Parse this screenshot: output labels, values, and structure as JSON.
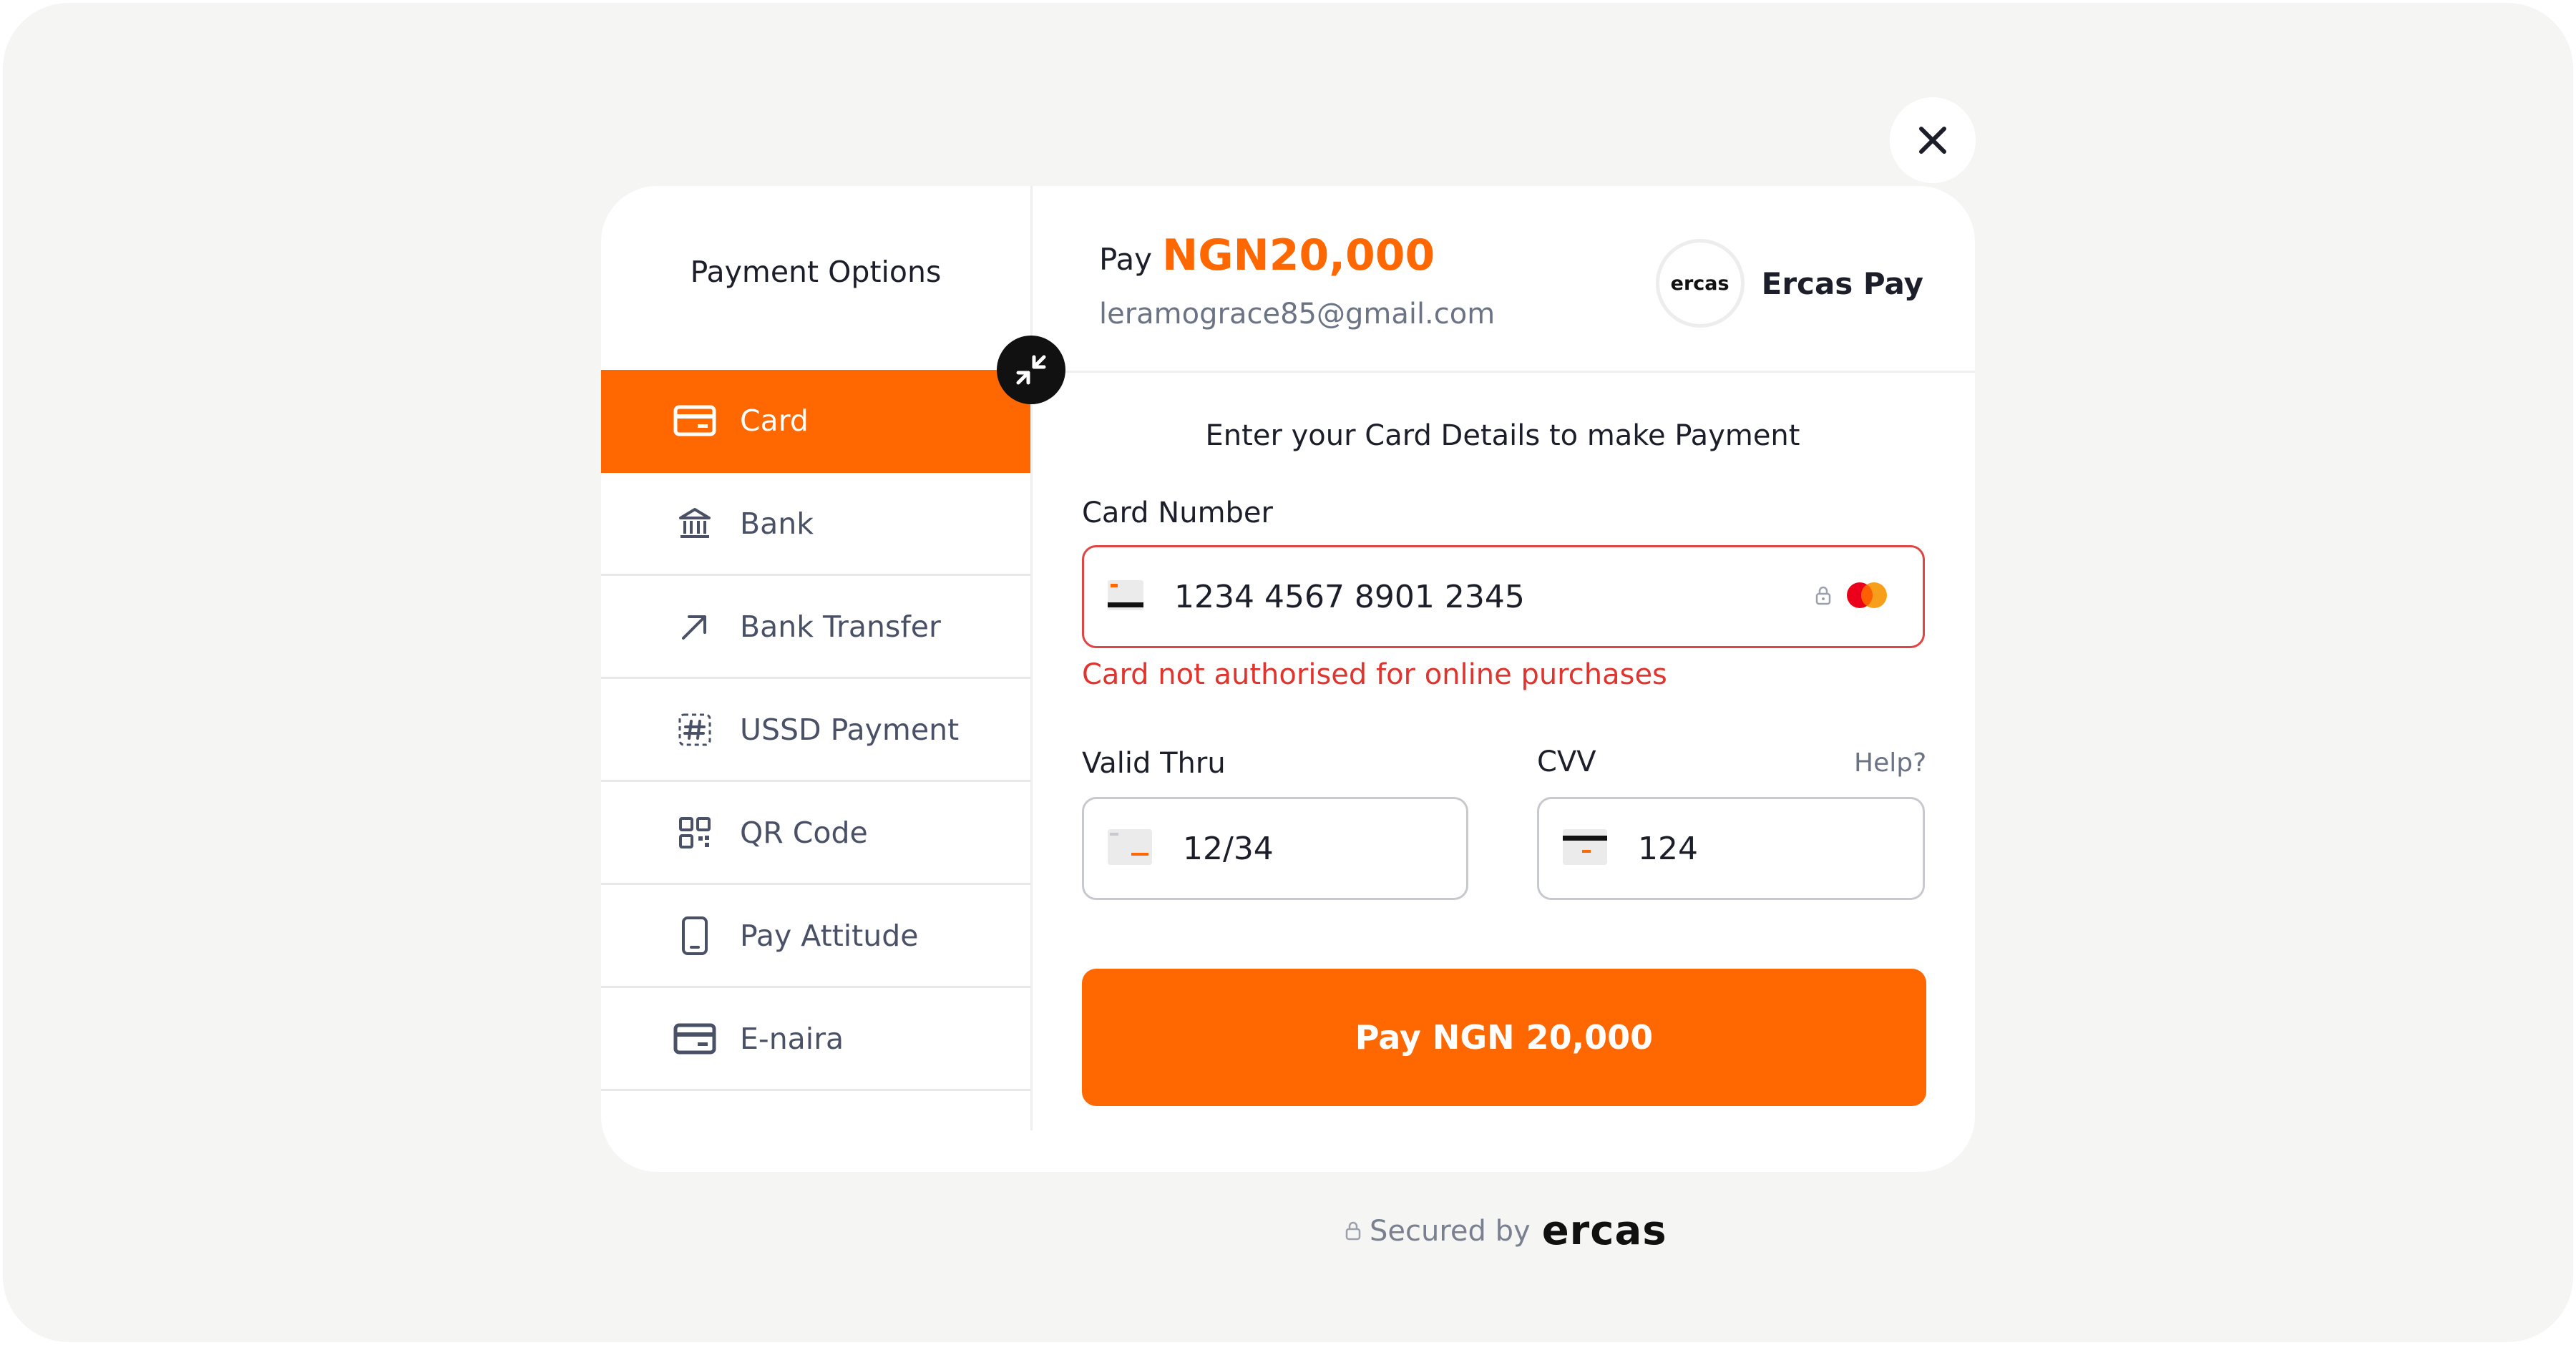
{
  "sidebar": {
    "title": "Payment Options",
    "items": [
      {
        "label": "Card",
        "icon": "credit-card-icon",
        "active": true
      },
      {
        "label": "Bank",
        "icon": "bank-icon"
      },
      {
        "label": "Bank Transfer",
        "icon": "arrow-up-right-icon"
      },
      {
        "label": "USSD Payment",
        "icon": "hashtag-icon"
      },
      {
        "label": "QR Code",
        "icon": "qr-code-icon"
      },
      {
        "label": "Pay Attitude",
        "icon": "mobile-phone-icon"
      },
      {
        "label": "E-naira",
        "icon": "credit-card-icon"
      }
    ]
  },
  "header": {
    "pay_word": "Pay",
    "amount": "NGN20,000",
    "email": "leramograce85@gmail.com",
    "merchant_logo_text": "ercas",
    "merchant_name": "Ercas Pay"
  },
  "form": {
    "instruction": "Enter your Card Details to make Payment",
    "card_number_label": "Card Number",
    "card_number_value": "1234 4567 8901 2345",
    "card_error": "Card not authorised for online purchases",
    "valid_thru_label": "Valid Thru",
    "valid_thru_value": "12/34",
    "cvv_label": "CVV",
    "cvv_value": "124",
    "help_label": "Help?",
    "pay_button_label": "Pay NGN 20,000"
  },
  "footer": {
    "secured_label": "Secured by",
    "brand": "ercas"
  },
  "colors": {
    "accent": "#ff6800",
    "error": "#e0342f",
    "background": "#f5f5f3"
  }
}
